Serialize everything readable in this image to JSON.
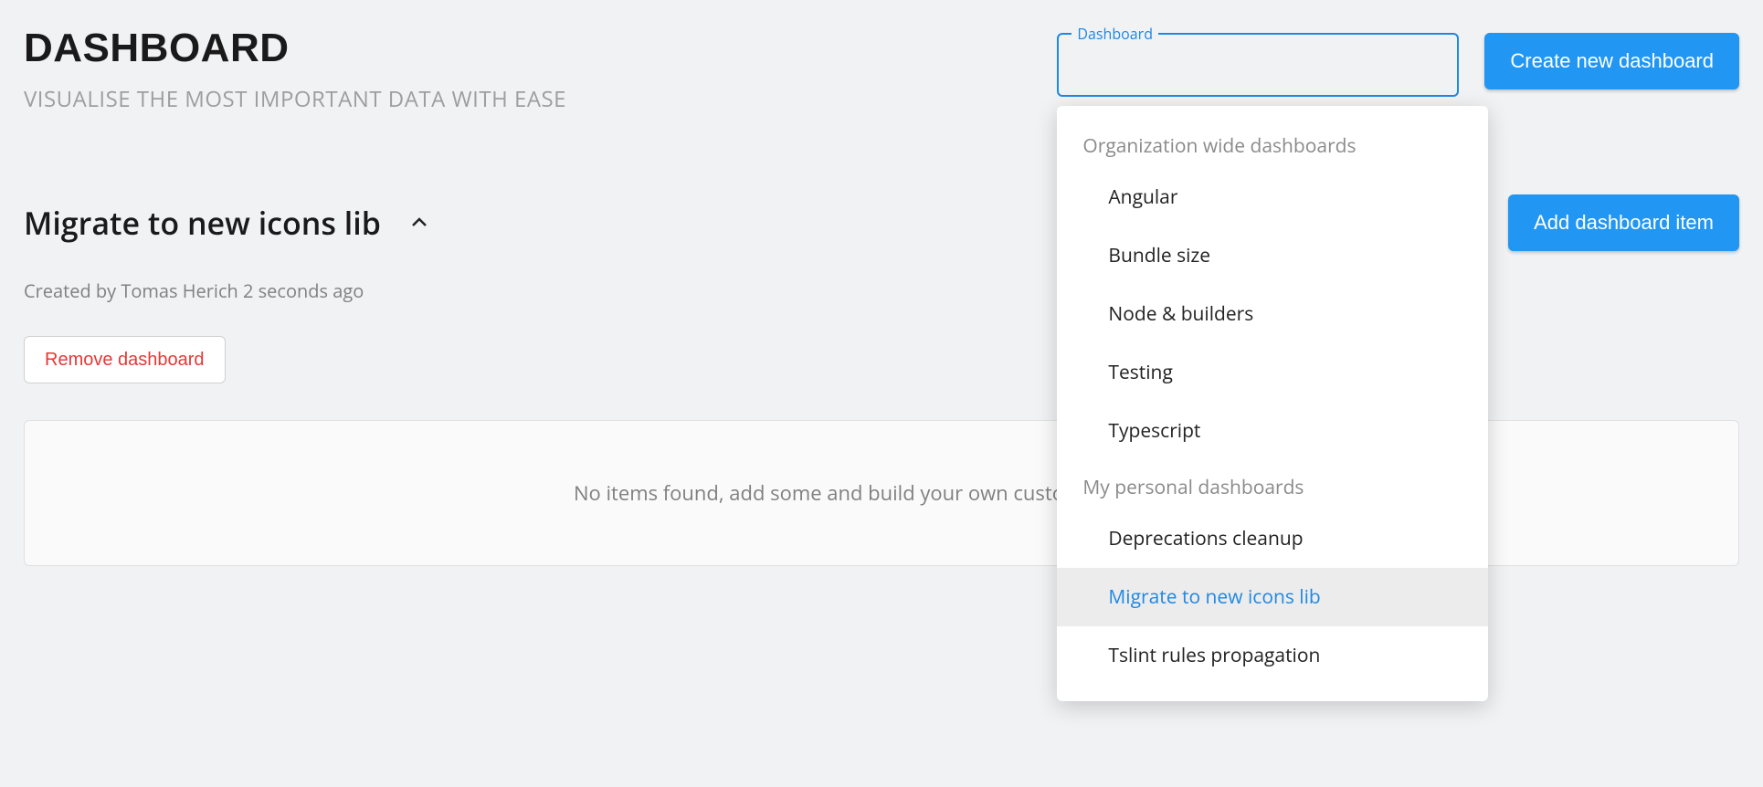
{
  "colors": {
    "primary": "#2196f3",
    "danger": "#e53935",
    "text_muted": "#808080"
  },
  "header": {
    "title": "DASHBOARD",
    "subtitle": "VISUALISE THE MOST IMPORTANT DATA WITH EASE",
    "create_button": "Create new dashboard"
  },
  "select": {
    "label": "Dashboard",
    "value": "",
    "groups": [
      {
        "label": "Organization wide dashboards",
        "options": [
          "Angular",
          "Bundle size",
          "Node & builders",
          "Testing",
          "Typescript"
        ]
      },
      {
        "label": "My personal dashboards",
        "options": [
          "Deprecations cleanup",
          "Migrate to new icons lib",
          "Tslint rules propagation"
        ]
      }
    ],
    "selected": "Migrate to new icons lib"
  },
  "dashboard": {
    "name": "Migrate to new icons lib",
    "created_by": "Created by Tomas Herich 2 seconds ago",
    "remove_button": "Remove dashboard",
    "add_item_button": "Add dashboard item",
    "empty_message": "No items found, add some and build your own custom dashboard"
  }
}
